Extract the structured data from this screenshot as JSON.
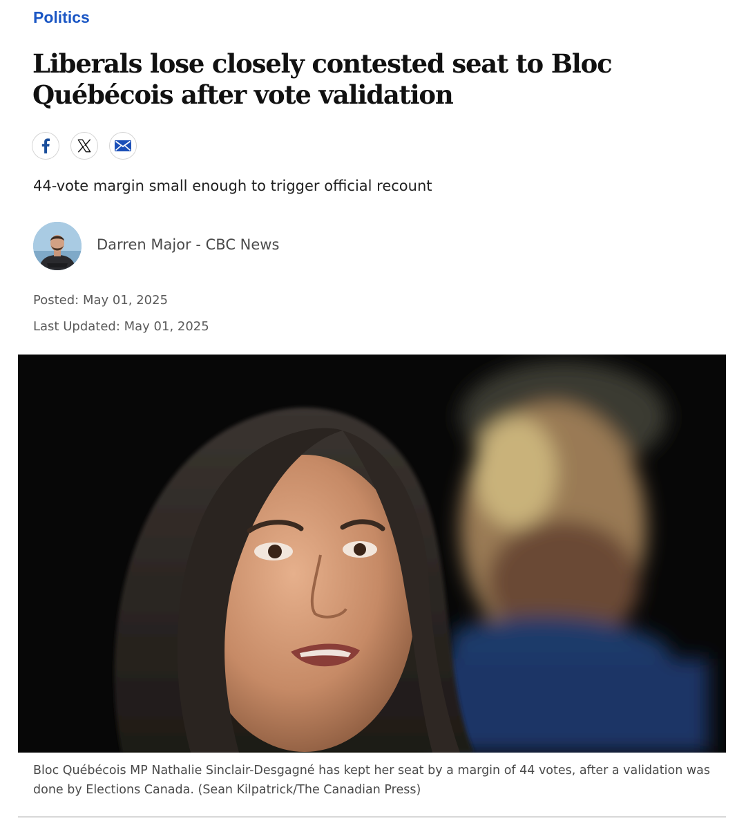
{
  "article": {
    "section": "Politics",
    "headline": "Liberals lose closely contested seat to Bloc Québécois after vote validation",
    "deck": "44-vote margin small enough to trigger official recount",
    "byline": "Darren Major - CBC News",
    "posted": "Posted: May 01, 2025",
    "updated": "Last Updated: May 01, 2025",
    "caption": "Bloc Québécois MP Nathalie Sinclair-Desgagné has kept her seat by a margin of 44 votes, after a validation was done by Elections Canada. (Sean Kilpatrick/The Canadian Press)"
  },
  "share": [
    {
      "icon": "facebook-icon"
    },
    {
      "icon": "x-icon"
    },
    {
      "icon": "email-icon"
    }
  ],
  "colors": {
    "section_link": "#1a56c4",
    "facebook": "#1b4f9c",
    "email": "#1b4fb8",
    "headline": "#111111",
    "meta_text": "#5a5a5a"
  }
}
